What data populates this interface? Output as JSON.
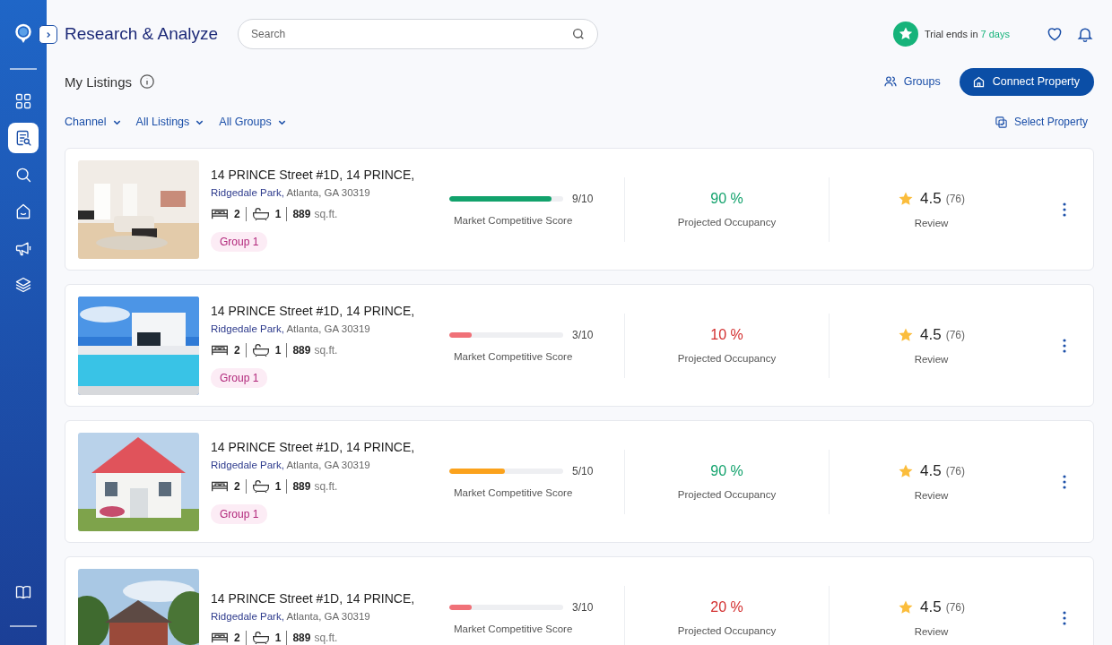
{
  "sidebar": {
    "items": [
      {
        "kind": "grid",
        "selected": false
      },
      {
        "kind": "listings",
        "selected": true
      },
      {
        "kind": "search",
        "selected": false
      },
      {
        "kind": "home",
        "selected": false
      },
      {
        "kind": "megaphone",
        "selected": false
      },
      {
        "kind": "layers",
        "selected": false
      }
    ],
    "bottom_items": [
      {
        "kind": "book",
        "selected": false
      }
    ]
  },
  "header": {
    "title": "Research & Analyze",
    "search": {
      "placeholder": "Search"
    },
    "trial": {
      "prefix": "Trial ends in",
      "highlight": "7 days"
    }
  },
  "section": {
    "title": "My Listings",
    "groups_link": "Groups",
    "connect_button": "Connect Property",
    "select_link": "Select Property"
  },
  "filters": [
    "Channel",
    "All Listings",
    "All Groups"
  ],
  "listings": [
    {
      "title": "14 PRINCE Street #1D, 14 PRINCE,",
      "neighborhood": "Ridgedale Park,",
      "city": "Atlanta, GA 30319",
      "beds": "2",
      "baths": "1",
      "area": "889",
      "area_unit": "sq.ft.",
      "group": "Group 1",
      "score": {
        "level": 0.9,
        "reading": "9/10",
        "color": "#12a26c",
        "label": "Market Competitive Score"
      },
      "occupancy": {
        "value": "90 %",
        "color": "#12a26c",
        "label": "Projected Occupancy"
      },
      "review": {
        "rating": "4.5",
        "count": "(76)",
        "label": "Review"
      }
    },
    {
      "title": "14 PRINCE Street #1D, 14 PRINCE,",
      "neighborhood": "Ridgedale Park,",
      "city": "Atlanta, GA 30319",
      "beds": "2",
      "baths": "1",
      "area": "889",
      "area_unit": "sq.ft.",
      "group": "Group 1",
      "score": {
        "level": 0.2,
        "reading": "3/10",
        "color": "#f07178",
        "label": "Market Competitive Score"
      },
      "occupancy": {
        "value": "10 %",
        "color": "#d32f2f",
        "label": "Projected Occupancy"
      },
      "review": {
        "rating": "4.5",
        "count": "(76)",
        "label": "Review"
      }
    },
    {
      "title": "14 PRINCE Street #1D, 14 PRINCE,",
      "neighborhood": "Ridgedale Park,",
      "city": "Atlanta, GA 30319",
      "beds": "2",
      "baths": "1",
      "area": "889",
      "area_unit": "sq.ft.",
      "group": "Group 1",
      "score": {
        "level": 0.49,
        "reading": "5/10",
        "color": "#fba21c",
        "label": "Market Competitive Score"
      },
      "occupancy": {
        "value": "90 %",
        "color": "#12a26c",
        "label": "Projected Occupancy"
      },
      "review": {
        "rating": "4.5",
        "count": "(76)",
        "label": "Review"
      }
    },
    {
      "title": "14 PRINCE Street #1D, 14 PRINCE,",
      "neighborhood": "Ridgedale Park,",
      "city": "Atlanta, GA 30319",
      "beds": "2",
      "baths": "1",
      "area": "889",
      "area_unit": "sq.ft.",
      "score": {
        "level": 0.2,
        "reading": "3/10",
        "color": "#f07178",
        "label": "Market Competitive Score"
      },
      "occupancy": {
        "value": "20 %",
        "color": "#d32f2f",
        "label": "Projected Occupancy"
      },
      "review": {
        "rating": "4.5",
        "count": "(76)",
        "label": "Review"
      }
    }
  ]
}
